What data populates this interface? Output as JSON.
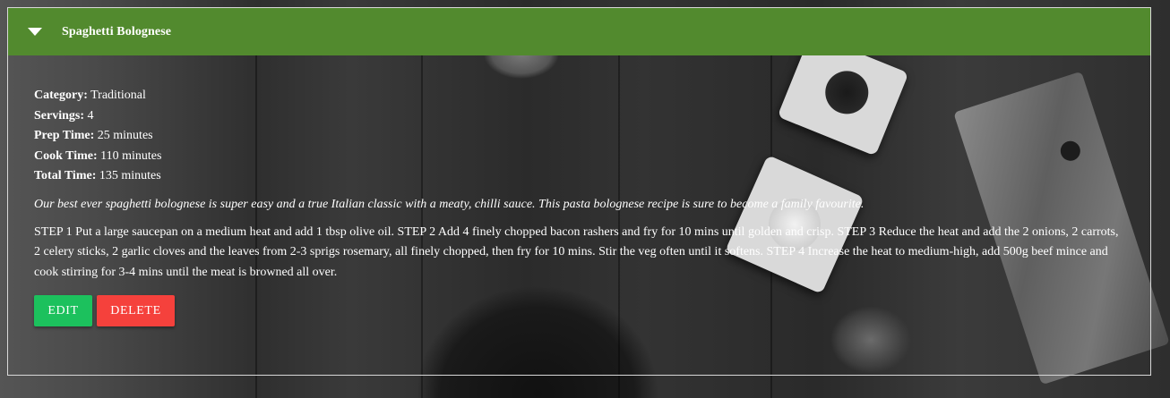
{
  "recipe": {
    "title": "Spaghetti Bolognese",
    "meta": [
      {
        "label": "Category:",
        "value": "Traditional"
      },
      {
        "label": "Servings:",
        "value": "4"
      },
      {
        "label": "Prep Time:",
        "value": "25 minutes"
      },
      {
        "label": "Cook Time:",
        "value": "110 minutes"
      },
      {
        "label": "Total Time:",
        "value": "135 minutes"
      }
    ],
    "description": "Our best ever spaghetti bolognese is super easy and a true Italian classic with a meaty, chilli sauce. This pasta bolognese recipe is sure to become a family favourite.",
    "steps": "STEP 1 Put a large saucepan on a medium heat and add 1 tbsp olive oil. STEP 2 Add 4 finely chopped bacon rashers and fry for 10 mins until golden and crisp. STEP 3 Reduce the heat and add the 2 onions, 2 carrots, 2 celery sticks, 2 garlic cloves and the leaves from 2-3 sprigs rosemary, all finely chopped, then fry for 10 mins. Stir the veg often until it softens. STEP 4 Increase the heat to medium-high, add 500g beef mince and cook stirring for 3-4 mins until the meat is browned all over."
  },
  "actions": {
    "edit_label": "Edit",
    "delete_label": "Delete"
  },
  "icons": {
    "toggle": "caret-down-icon"
  },
  "colors": {
    "header": "#528a2e",
    "edit": "#1cc15d",
    "delete": "#f5413c"
  }
}
